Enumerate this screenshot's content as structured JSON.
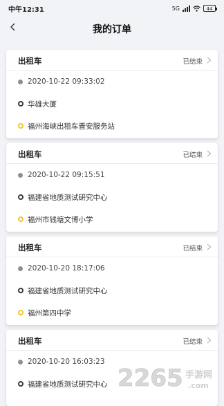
{
  "status_bar": {
    "time": "中午12:31",
    "network": "5G",
    "battery": "44"
  },
  "header": {
    "title": "我的订单"
  },
  "orders": [
    {
      "type": "出租车",
      "status": "已结束",
      "time": "2020-10-22 09:33:02",
      "start": "华雄大厦",
      "end": "福州海峡出租车晋安服务站"
    },
    {
      "type": "出租车",
      "status": "已结束",
      "time": "2020-10-22 09:15:51",
      "start": "福建省地质测试研究中心",
      "end": "福州市钱塘文博小学"
    },
    {
      "type": "出租车",
      "status": "已结束",
      "time": "2020-10-20 18:17:06",
      "start": "福建省地质测试研究中心",
      "end": "福州第四中学"
    },
    {
      "type": "出租车",
      "status": "已结束",
      "time": "2020-10-20 16:03:23",
      "start": "福建省地质测试研究中心",
      "end": ""
    }
  ],
  "watermark": {
    "brand": "2265",
    "site": "手游网",
    "url": ".com"
  },
  "colors": {
    "background": "#f2f3f6",
    "end_marker": "#f4c430",
    "start_marker": "#3a3a3a"
  }
}
